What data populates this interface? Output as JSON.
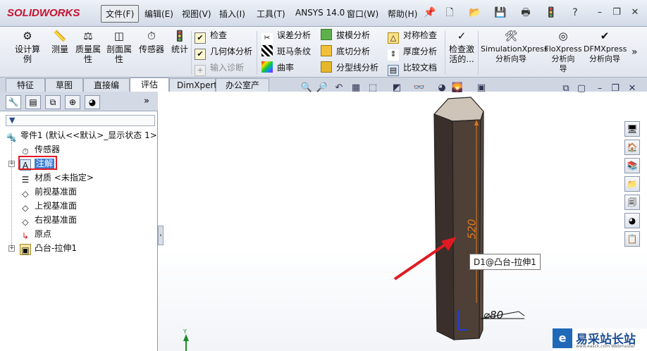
{
  "menubar": {
    "logo": "SOLIDWORKS",
    "items": [
      "文件(F)",
      "编辑(E)",
      "视图(V)",
      "插入(I)",
      "工具(T)",
      "ANSYS 14.0",
      "窗口(W)",
      "帮助(H)"
    ],
    "help_icon": "?"
  },
  "ribbon": {
    "big": [
      {
        "label": "设计算\n例",
        "icon": "design-study-icon"
      },
      {
        "label": "测量",
        "icon": "measure-icon"
      },
      {
        "label": "质量属\n性",
        "icon": "mass-properties-icon"
      },
      {
        "label": "剖面属\n性",
        "icon": "section-properties-icon"
      },
      {
        "label": "传感器",
        "icon": "sensor-icon"
      },
      {
        "label": "统计",
        "icon": "statistics-icon"
      }
    ],
    "col1": [
      "检查",
      "几何体分析",
      "输入诊断"
    ],
    "col2": [
      "误差分析",
      "斑马条纹",
      "曲率"
    ],
    "col3": [
      "拔模分析",
      "底切分析",
      "分型线分析"
    ],
    "col4": [
      "对称检查",
      "厚度分析",
      "比较文档"
    ],
    "activate": "检查激\n活的...",
    "xpress": [
      {
        "label": "SimulationXpress\n分析向导"
      },
      {
        "label": "FloXpress\n分析向\n导"
      },
      {
        "label": "DFMXpress\n分析向导"
      }
    ]
  },
  "tabs": [
    "特征",
    "草图",
    "直接编辑",
    "评估",
    "DimXpert",
    "办公室产品"
  ],
  "active_tab": "评估",
  "tree": {
    "root": "零件1  (默认<<默认>_显示状态 1>",
    "items": [
      "传感器",
      "注解",
      "材质 <未指定>",
      "前视基准面",
      "上视基准面",
      "右视基准面",
      "原点",
      "凸台-拉伸1"
    ]
  },
  "graphics": {
    "tooltip": "D1@凸台-拉伸1",
    "dim_height": "520",
    "dim_dia": "⌀80",
    "axis_label": "Y"
  },
  "watermark": {
    "logo": "e",
    "title": "易采站长站",
    "subtitle": "www.easck.com Webmaster"
  },
  "colors": {
    "accent_red": "#e11a22",
    "dim_orange": "#e07818",
    "prism_dark": "#4a3b34",
    "prism_top": "#c8bcb0"
  }
}
